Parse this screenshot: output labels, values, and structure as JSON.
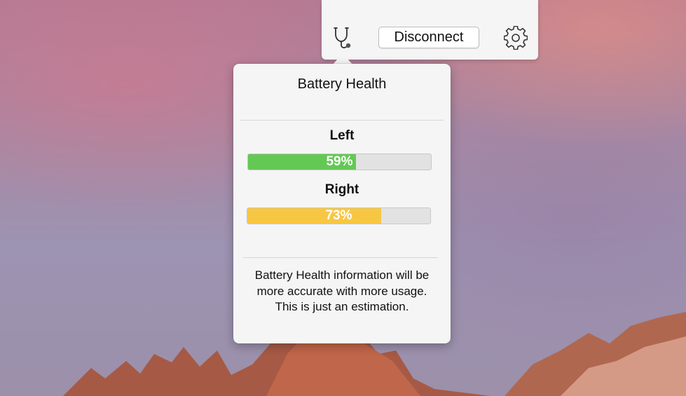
{
  "toolbar": {
    "stethoscope_icon": "stethoscope-icon",
    "disconnect_label": "Disconnect",
    "settings_icon": "gear-icon"
  },
  "panel": {
    "title": "Battery Health",
    "left": {
      "label": "Left",
      "percent_text": "59%",
      "level": 0.59,
      "color": "#63c854"
    },
    "right": {
      "label": "Right",
      "percent_text": "73%",
      "level": 0.73,
      "color": "#f7c744"
    },
    "note_lines": [
      "Battery Health information will be",
      "more accurate with more usage.",
      "This is just an estimation."
    ]
  }
}
